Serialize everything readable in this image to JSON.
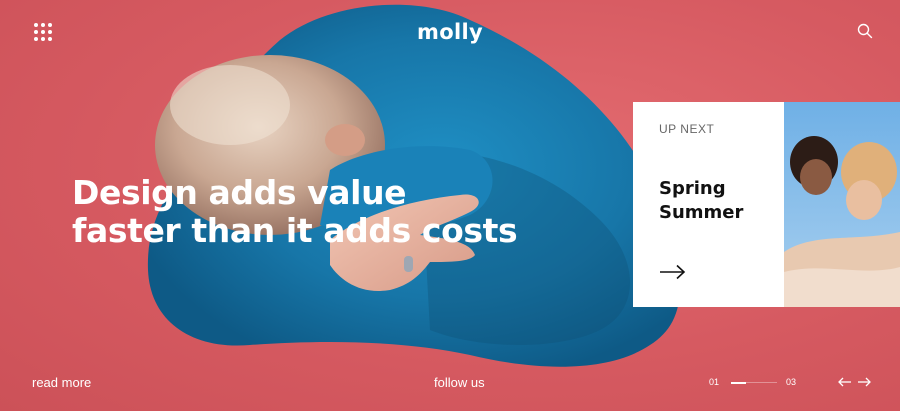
{
  "header": {
    "logo": "molly",
    "menu_icon": "grid-dots-icon",
    "search_icon": "search-icon"
  },
  "hero": {
    "headline_lines": [
      "Design adds value",
      "faster than it adds costs"
    ]
  },
  "up_next": {
    "eyebrow": "UP NEXT",
    "title_lines": [
      "Spring",
      "Summer"
    ],
    "arrow_icon": "arrow-right-icon"
  },
  "footer": {
    "read_more": "read more",
    "follow_us": "follow us",
    "pager": {
      "start": "01",
      "end": "03",
      "progress": 0.33
    },
    "prev_icon": "arrow-left-icon",
    "next_icon": "arrow-right-icon"
  },
  "colors": {
    "background": "#d85d63",
    "sweater": "#1a7fb0",
    "card": "#ffffff",
    "text": "#ffffff"
  }
}
